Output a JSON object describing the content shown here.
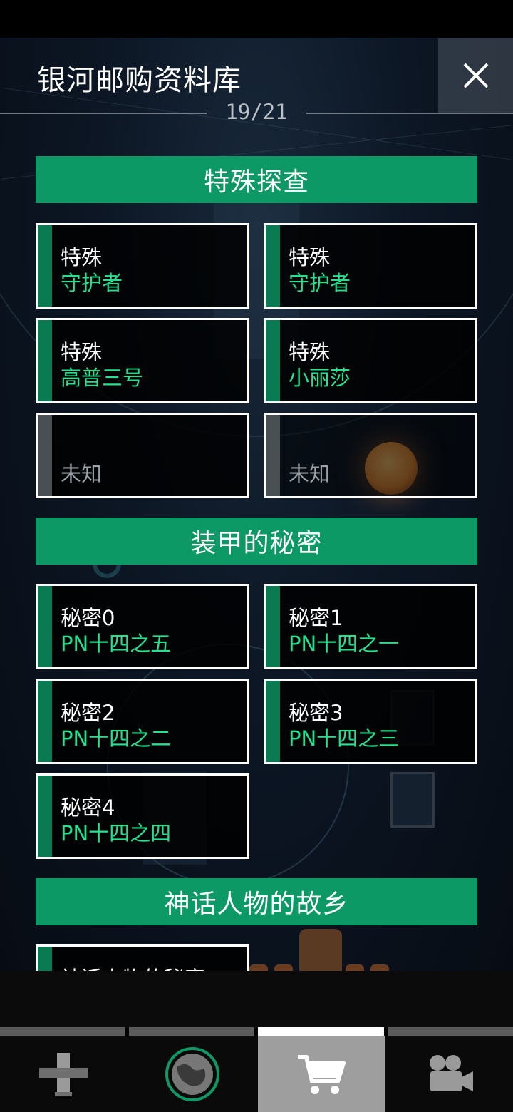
{
  "header": {
    "title": "银河邮购资料库",
    "counter": "19/21"
  },
  "sections": [
    {
      "title": "特殊探查",
      "cards": [
        {
          "line1": "特殊",
          "line2": "守护者",
          "unknown": false
        },
        {
          "line1": "特殊",
          "line2": "守护者",
          "unknown": false
        },
        {
          "line1": "特殊",
          "line2": "高普三号",
          "unknown": false
        },
        {
          "line1": "特殊",
          "line2": "小丽莎",
          "unknown": false
        },
        {
          "line1": "",
          "line2": "未知",
          "unknown": true
        },
        {
          "line1": "",
          "line2": "未知",
          "unknown": true
        }
      ]
    },
    {
      "title": "装甲的秘密",
      "cards": [
        {
          "line1": "秘密0",
          "line2": "PN十四之五",
          "unknown": false
        },
        {
          "line1": "秘密1",
          "line2": "PN十四之一",
          "unknown": false
        },
        {
          "line1": "秘密2",
          "line2": "PN十四之二",
          "unknown": false
        },
        {
          "line1": "秘密3",
          "line2": "PN十四之三",
          "unknown": false
        },
        {
          "line1": "秘密4",
          "line2": "PN十四之四",
          "unknown": false
        }
      ]
    },
    {
      "title": "神话人物的故乡",
      "cards": [
        {
          "line1": "神话人物的秘密",
          "line2": "",
          "unknown": false
        }
      ]
    }
  ],
  "nav": {
    "tabs": [
      {
        "icon": "upgrade-icon",
        "active": false
      },
      {
        "icon": "planet-icon",
        "active": false
      },
      {
        "icon": "cart-icon",
        "active": true
      },
      {
        "icon": "camera-icon",
        "active": false
      }
    ]
  },
  "colors": {
    "accent_green": "#0d9966",
    "text_green": "#25e08f",
    "stripe_green": "#0a7a52"
  }
}
